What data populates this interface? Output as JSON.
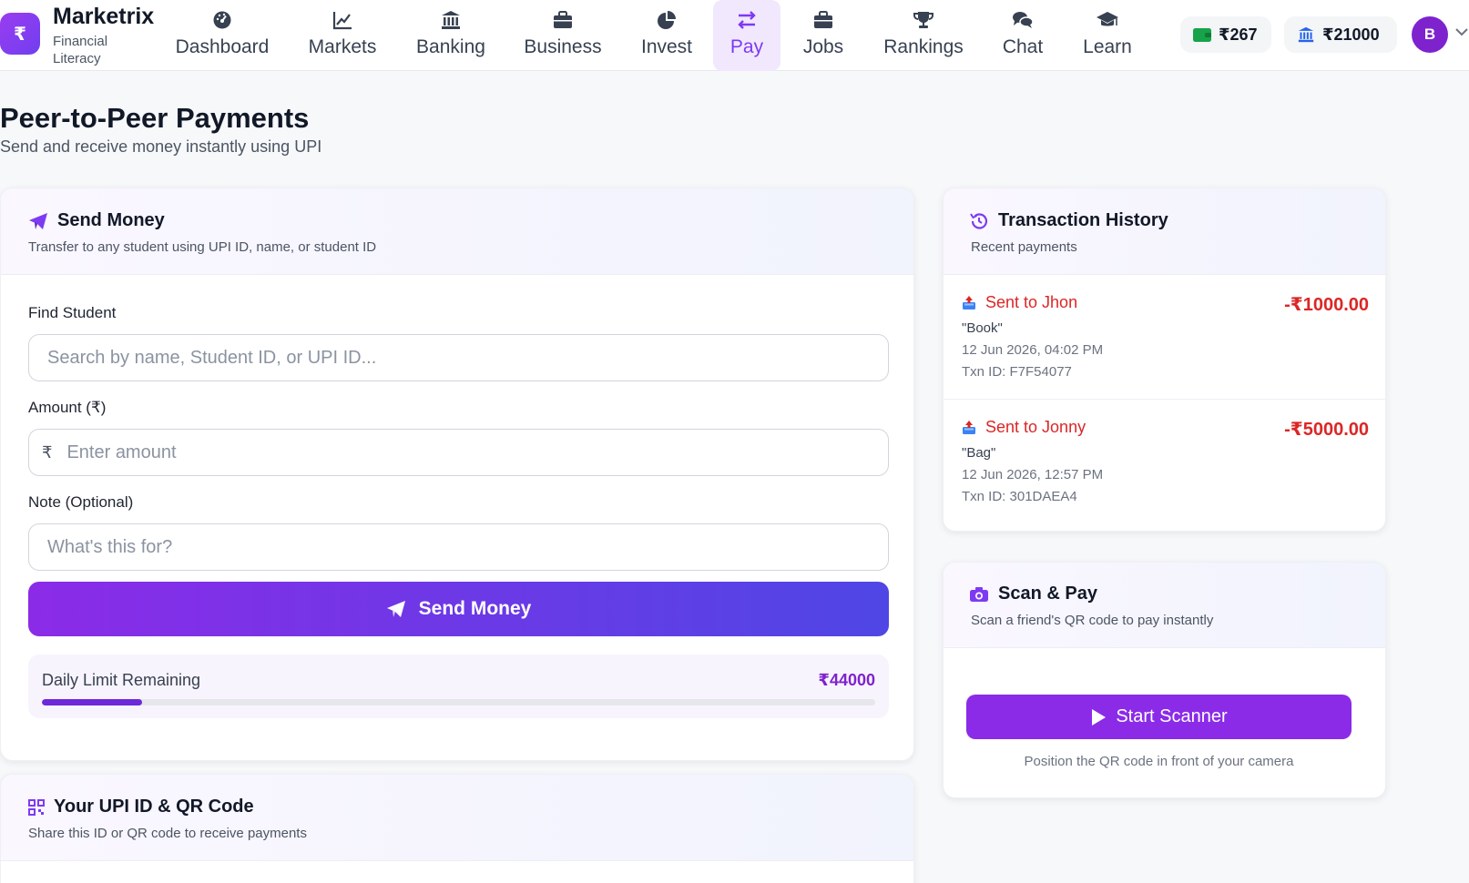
{
  "brand": {
    "logo_symbol": "₹",
    "name": "Marketrix",
    "tagline": "Financial Literacy"
  },
  "nav": [
    {
      "label": "Dashboard",
      "icon": "gauge-icon"
    },
    {
      "label": "Markets",
      "icon": "chart-line-icon"
    },
    {
      "label": "Banking",
      "icon": "bank-icon"
    },
    {
      "label": "Business",
      "icon": "briefcase-icon"
    },
    {
      "label": "Invest",
      "icon": "pie-chart-icon"
    },
    {
      "label": "Pay",
      "icon": "transfer-arrows-icon",
      "active": true
    },
    {
      "label": "Jobs",
      "icon": "briefcase-icon"
    },
    {
      "label": "Rankings",
      "icon": "trophy-icon"
    },
    {
      "label": "Chat",
      "icon": "chat-bubbles-icon"
    },
    {
      "label": "Learn",
      "icon": "graduation-cap-icon"
    }
  ],
  "balances": {
    "wallet": "₹267",
    "bank": "₹21000"
  },
  "user": {
    "avatar_initial": "B"
  },
  "page": {
    "title": "Peer-to-Peer Payments",
    "subtitle": "Send and receive money instantly using UPI"
  },
  "send_money": {
    "title": "Send Money",
    "description": "Transfer to any student using UPI ID, name, or student ID",
    "find_label": "Find Student",
    "find_placeholder": "Search by name, Student ID, or UPI ID...",
    "amount_label": "Amount (₹)",
    "amount_prefix": "₹",
    "amount_placeholder": "Enter amount",
    "note_label": "Note (Optional)",
    "note_placeholder": "What's this for?",
    "button_label": "Send Money",
    "limit_label": "Daily Limit Remaining",
    "limit_value": "₹44000",
    "limit_fraction_used": 0.12
  },
  "upi_card": {
    "title": "Your UPI ID & QR Code",
    "description": "Share this ID or QR code to receive payments"
  },
  "history": {
    "title": "Transaction History",
    "description": "Recent payments",
    "items": [
      {
        "title": "Sent to Jhon",
        "amount": "-₹1000.00",
        "note": "\"Book\"",
        "date": "12 Jun 2026, 04:02 PM",
        "txn_id": "Txn ID: F7F54077"
      },
      {
        "title": "Sent to Jonny",
        "amount": "-₹5000.00",
        "note": "\"Bag\"",
        "date": "12 Jun 2026, 12:57 PM",
        "txn_id": "Txn ID: 301DAEA4"
      }
    ]
  },
  "scan": {
    "title": "Scan & Pay",
    "description": "Scan a friend's QR code to pay instantly",
    "button_label": "Start Scanner",
    "hint": "Position the QR code in front of your camera"
  },
  "colors": {
    "accent": "#7e22ce",
    "danger": "#dc2626",
    "wallet_green": "#16a34a",
    "bank_blue": "#2563eb"
  }
}
